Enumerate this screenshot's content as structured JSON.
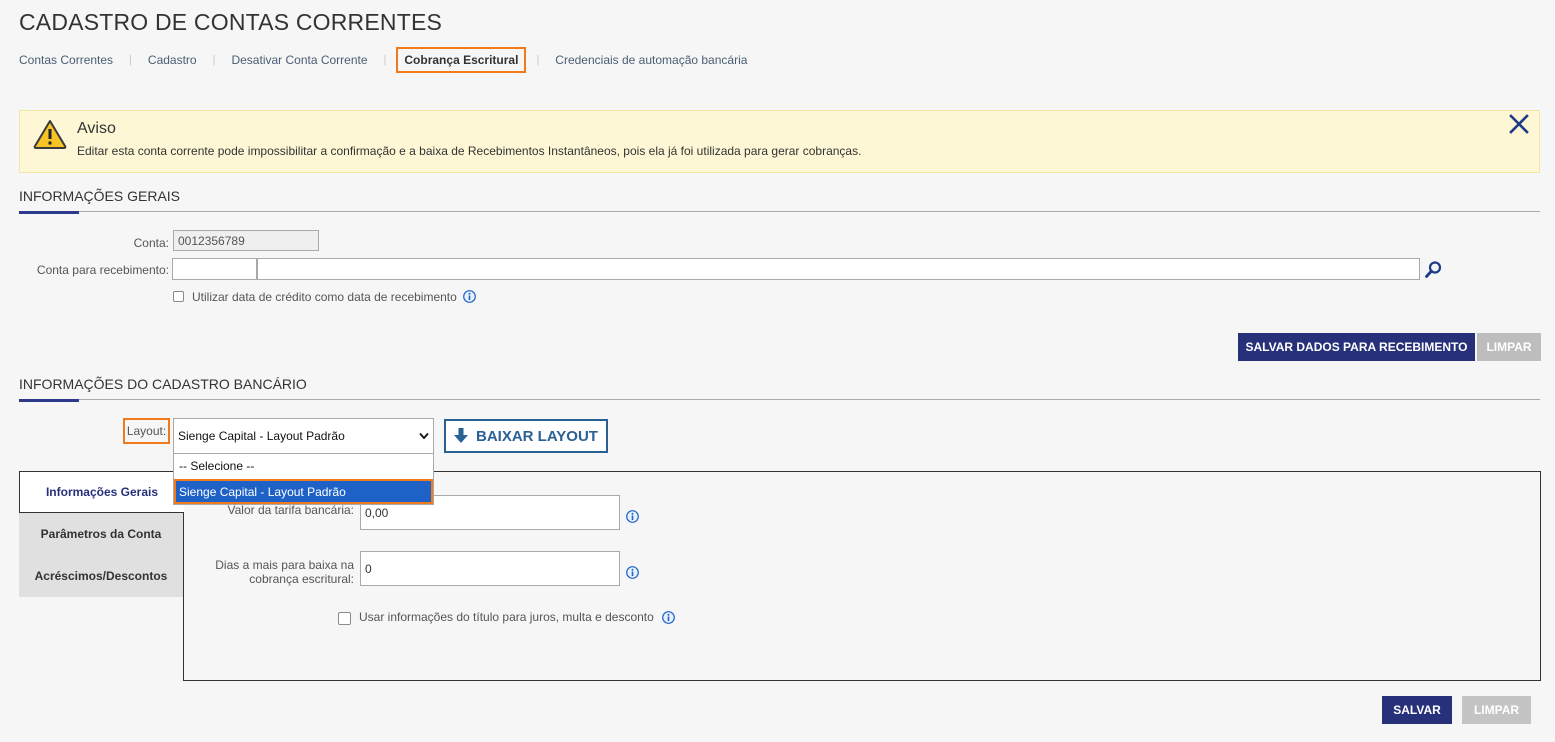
{
  "page": {
    "title": "CADASTRO DE CONTAS CORRENTES"
  },
  "nav": {
    "items": [
      {
        "label": "Contas Correntes"
      },
      {
        "label": "Cadastro"
      },
      {
        "label": "Desativar Conta Corrente"
      },
      {
        "label": "Cobrança Escritural",
        "active": true
      },
      {
        "label": "Credenciais de automação bancária"
      }
    ],
    "separator": "|"
  },
  "alert": {
    "title": "Aviso",
    "message": "Editar esta conta corrente pode impossibilitar a confirmação e a baixa de Recebimentos Instantâneos, pois ela já foi utilizada para gerar cobranças.",
    "icon": "warning-icon",
    "close_icon": "close-icon"
  },
  "general": {
    "title": "INFORMAÇÕES GERAIS",
    "conta_label": "Conta:",
    "conta_value": "0012356789",
    "recebimento_label": "Conta para recebimento:",
    "recebimento_code": "",
    "recebimento_name": "",
    "use_credit_date_label": "Utilizar data de crédito como data de recebimento",
    "use_credit_date_checked": false,
    "save_label": "SALVAR DADOS PARA RECEBIMENTO",
    "clear_label": "LIMPAR"
  },
  "bank": {
    "title": "INFORMAÇÕES DO CADASTRO BANCÁRIO",
    "layout_label": "Layout:",
    "layout_selected": "Sienge Capital - Layout Padrão",
    "layout_options": [
      "-- Selecione --",
      "Sienge Capital - Layout Padrão"
    ],
    "download_label": "BAIXAR LAYOUT",
    "tabs": [
      {
        "label": "Informações Gerais",
        "active": true
      },
      {
        "label": "Parâmetros da Conta"
      },
      {
        "label": "Acréscimos/Descontos"
      }
    ],
    "tarifa_label": "Valor da tarifa bancária:",
    "tarifa_value": "0,00",
    "dias_label_1": "Dias a mais para baixa na",
    "dias_label_2": "cobrança escritural:",
    "dias_value": "0",
    "usar_info_label": "Usar informações do título para juros, multa e desconto",
    "usar_info_checked": false,
    "save_label": "SALVAR",
    "clear_label": "LIMPAR"
  },
  "colors": {
    "primary": "#27317a",
    "highlight": "#f07b1e",
    "alert_bg": "#fdf7d5",
    "selected_option": "#1e62c8"
  }
}
